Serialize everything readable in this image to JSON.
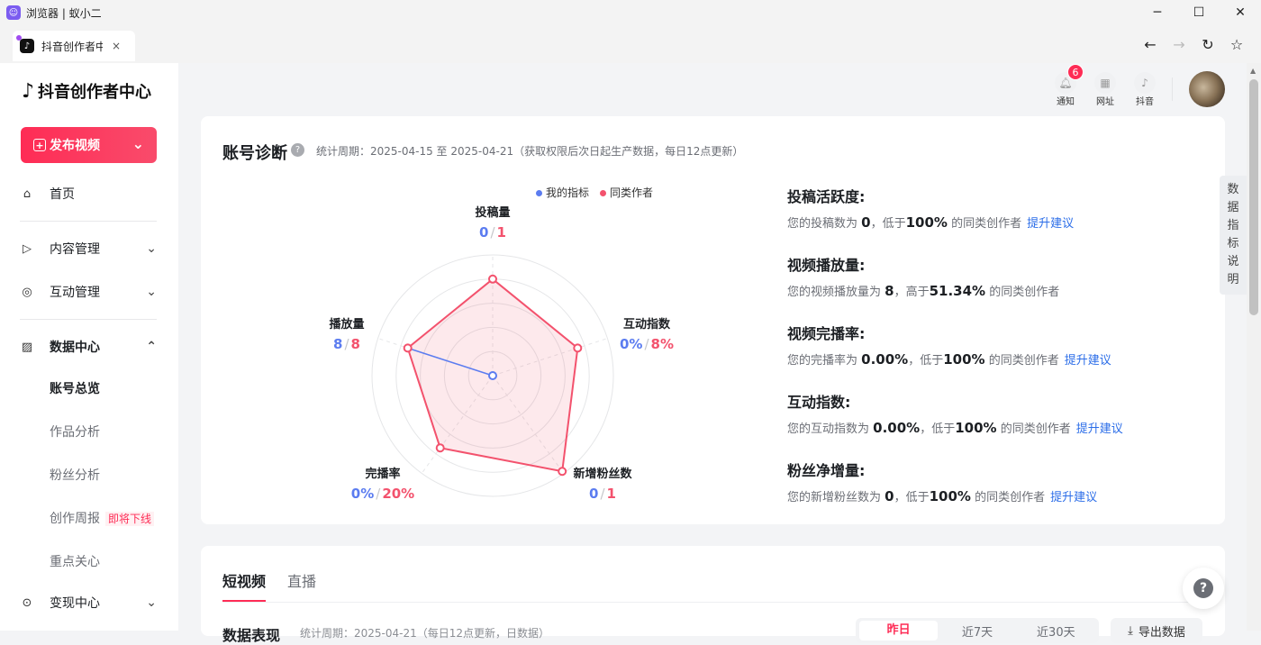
{
  "window": {
    "title": "浏览器 | 蚁小二",
    "minimize": "─",
    "maximize": "☐",
    "close": "✕"
  },
  "tab": {
    "name": "抖音创作者中",
    "close": "×"
  },
  "nav": {
    "back": "←",
    "forward": "→",
    "reload": "↻",
    "bookmark": "☆"
  },
  "sidebar": {
    "logo": "抖音创作者中心",
    "publish": "发布视频",
    "home": "首页",
    "content": "内容管理",
    "interaction": "互动管理",
    "data_center": "数据中心",
    "subs": [
      "账号总览",
      "作品分析",
      "粉丝分析",
      "创作周报",
      "重点关心"
    ],
    "weekly_badge": "即将下线",
    "monetize": "变现中心"
  },
  "header": {
    "notify": "通知",
    "notify_count": "6",
    "site": "网址",
    "douyin": "抖音"
  },
  "diagnosis": {
    "title": "账号诊断",
    "period": "统计周期：2025-04-15 至 2025-04-21（获取权限后次日起生产数据，每日12点更新）",
    "legend_mine": "我的指标",
    "legend_peer": "同类作者",
    "colors": {
      "mine": "#5b7cf0",
      "peer": "#f3526d"
    },
    "axes": [
      {
        "name": "投稿量",
        "mine": "0",
        "peer": "1"
      },
      {
        "name": "互动指数",
        "mine": "0%",
        "peer": "8%"
      },
      {
        "name": "新增粉丝数",
        "mine": "0",
        "peer": "1"
      },
      {
        "name": "完播率",
        "mine": "0%",
        "peer": "20%"
      },
      {
        "name": "播放量",
        "mine": "8",
        "peer": "8"
      }
    ],
    "radar_levels": {
      "mine": [
        0,
        0,
        0,
        0,
        0.74
      ],
      "peer": [
        0.8,
        0.74,
        0.98,
        0.74,
        0.74
      ]
    },
    "metrics": [
      {
        "title": "投稿活跃度:",
        "pre": "您的投稿数为",
        "val": "0",
        "mid": "，低于",
        "pct": "100%",
        "post": "的同类创作者",
        "link": "提升建议"
      },
      {
        "title": "视频播放量:",
        "pre": "您的视频播放量为",
        "val": "8",
        "mid": "，高于",
        "pct": "51.34%",
        "post": "的同类创作者",
        "link": ""
      },
      {
        "title": "视频完播率:",
        "pre": "您的完播率为",
        "val": "0.00%",
        "mid": "，低于",
        "pct": "100%",
        "post": "的同类创作者",
        "link": "提升建议"
      },
      {
        "title": "互动指数:",
        "pre": "您的互动指数为",
        "val": "0.00%",
        "mid": "，低于",
        "pct": "100%",
        "post": "的同类创作者",
        "link": "提升建议"
      },
      {
        "title": "粉丝净增量:",
        "pre": "您的新增粉丝数为",
        "val": "0",
        "mid": "，低于",
        "pct": "100%",
        "post": "的同类创作者",
        "link": "提升建议"
      }
    ]
  },
  "side_tab": [
    "数",
    "据",
    "指",
    "标",
    "说",
    "明"
  ],
  "lower": {
    "tabs": [
      "短视频",
      "直播"
    ],
    "title": "数据表现",
    "sub": "统计周期：2025-04-21（每日12点更新，日数据）",
    "ranges": [
      "昨日",
      "近7天",
      "近30天"
    ],
    "export": "导出数据"
  },
  "help_float": "?"
}
